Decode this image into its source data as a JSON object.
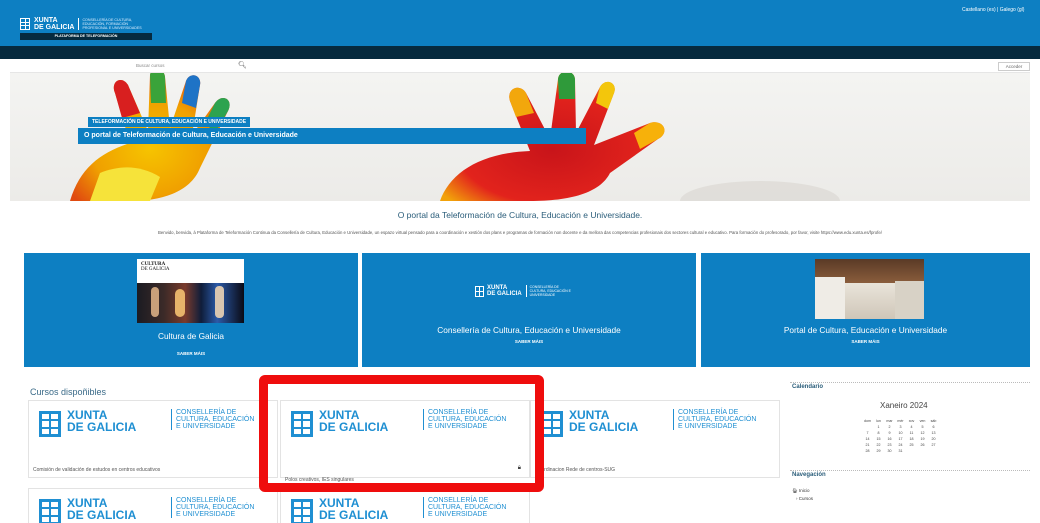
{
  "header": {
    "logo_text_1": "XUNTA",
    "logo_text_2": "DE GALICIA",
    "department_lines": [
      "CONSELLERÍA DE CULTURA,",
      "EDUCACIÓN, FORMACIÓN",
      "PROFESIONAL E UNIVERSIDADES"
    ],
    "platform_label": "PLATAFORMA DE TELEFORMACIÓN",
    "top_links": "Castellano (es) | Galego (gl)"
  },
  "search": {
    "placeholder": "Buscar cursos",
    "icon": "search-icon"
  },
  "access_button": "Acceder",
  "hero": {
    "tag": "TELEFORMACIÓN DE CULTURA, EDUCACIÓN E UNIVERSIDADE",
    "title": "O portal de Teleformación de Cultura, Educación e Universidade"
  },
  "intro": {
    "title": "O portal da Teleformación de Cultura, Educación e Universidade.",
    "text": "Benvido, benvida, á Plataforma de Teleformación Continua da Consellería de Cultura, Educación e Universidade, un espazo virtual pensado para a coordinación e xestión dos plans e programas de formación non docente e da mellora das competencias profesionais dos sectores cultural e educativo. Para formación do profesorado, por favor, visite https://www.edu.xunta.es/fprofe/"
  },
  "cards": [
    {
      "logo_line_1": "CULTURA",
      "logo_line_2": "DE GALICIA",
      "title": "Cultura de Galicia",
      "action": "SABER MÁIS"
    },
    {
      "logo_line_1": "XUNTA",
      "logo_line_2": "DE GALICIA",
      "dept": "CONSELLERÍA DE CULTURA, EDUCACIÓN E UNIVERSIDADE",
      "title": "Consellería de Cultura, Educación e Universidade",
      "action": "SABER MÁIS"
    },
    {
      "title": "Portal de Cultura, Educación e Universidade",
      "action": "SABER MÁIS"
    }
  ],
  "courses": {
    "heading": "Cursos dispoñibles",
    "logo": {
      "xunta": "XUNTA",
      "galicia": "DE GALICIA",
      "cons_1": "CONSELLERÍA DE",
      "cons_2": "CULTURA, EDUCACIÓN",
      "cons_3": "E UNIVERSIDADE"
    },
    "items": [
      {
        "name": "Comisión de validación de estudos en centros educativos"
      },
      {
        "name": "Polos creativos, IES singulares",
        "locked": true
      },
      {
        "name": "Coordinacion Rede de centros-SUG"
      },
      {
        "name": ""
      },
      {
        "name": ""
      }
    ]
  },
  "sidebar": {
    "calendar": {
      "title": "Calendario",
      "month": "Xaneiro 2024",
      "weekdays": [
        "dom",
        "lun",
        "mar",
        "mér",
        "xov",
        "ven",
        "sáb"
      ],
      "weeks": [
        [
          "",
          "1",
          "2",
          "3",
          "4",
          "5",
          "6"
        ],
        [
          "7",
          "8",
          "9",
          "10",
          "11",
          "12",
          "13"
        ],
        [
          "14",
          "15",
          "16",
          "17",
          "18",
          "19",
          "20"
        ],
        [
          "21",
          "22",
          "23",
          "24",
          "25",
          "26",
          "27"
        ],
        [
          "28",
          "29",
          "30",
          "31",
          "",
          "",
          ""
        ]
      ]
    },
    "navigation": {
      "title": "Navegación",
      "home": "Inicio",
      "courses": "Cursos"
    }
  },
  "colors": {
    "brand_blue": "#0d7fc2",
    "navy": "#062a3e",
    "highlight_red": "#ef0d0d"
  }
}
